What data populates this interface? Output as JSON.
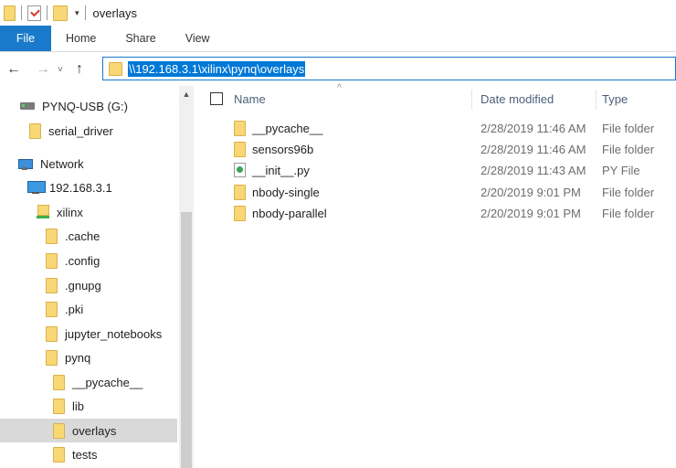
{
  "window": {
    "title": "overlays"
  },
  "ribbon": {
    "tabs": [
      {
        "label": "File"
      },
      {
        "label": "Home"
      },
      {
        "label": "Share"
      },
      {
        "label": "View"
      }
    ]
  },
  "address": {
    "path": "\\\\192.168.3.1\\xilinx\\pynq\\overlays",
    "back_icon": "←",
    "forward_icon": "→",
    "recent_icon": "˅",
    "up_icon": "↑"
  },
  "navigation": {
    "items": [
      {
        "label": "PYNQ-USB (G:)",
        "icon": "usb-drive-icon"
      },
      {
        "label": "serial_driver",
        "icon": "folder-icon"
      },
      {
        "label": "Network",
        "icon": "network-icon"
      },
      {
        "label": "192.168.3.1",
        "icon": "computer-icon"
      },
      {
        "label": "xilinx",
        "icon": "network-share-icon"
      },
      {
        "label": ".cache",
        "icon": "folder-icon"
      },
      {
        "label": ".config",
        "icon": "folder-icon"
      },
      {
        "label": ".gnupg",
        "icon": "folder-icon"
      },
      {
        "label": ".pki",
        "icon": "folder-icon"
      },
      {
        "label": "jupyter_notebooks",
        "icon": "folder-icon"
      },
      {
        "label": "pynq",
        "icon": "folder-icon"
      },
      {
        "label": "__pycache__",
        "icon": "folder-icon"
      },
      {
        "label": "lib",
        "icon": "folder-icon"
      },
      {
        "label": "overlays",
        "icon": "folder-icon",
        "selected": true
      },
      {
        "label": "tests",
        "icon": "folder-icon"
      }
    ]
  },
  "columns": {
    "name": "Name",
    "date": "Date modified",
    "type": "Type",
    "sort_indicator": "^"
  },
  "files": [
    {
      "name": "__pycache__",
      "date": "2/28/2019 11:46 AM",
      "type": "File folder",
      "icon": "folder-icon"
    },
    {
      "name": "sensors96b",
      "date": "2/28/2019 11:46 AM",
      "type": "File folder",
      "icon": "folder-icon"
    },
    {
      "name": "__init__.py",
      "date": "2/28/2019 11:43 AM",
      "type": "PY File",
      "icon": "python-file-icon"
    },
    {
      "name": "nbody-single",
      "date": "2/20/2019 9:01 PM",
      "type": "File folder",
      "icon": "folder-icon"
    },
    {
      "name": "nbody-parallel",
      "date": "2/20/2019 9:01 PM",
      "type": "File folder",
      "icon": "folder-icon"
    }
  ],
  "colors": {
    "accent": "#1979ca",
    "selection": "#0078d7",
    "folder": "#f8d775",
    "nav_selected": "#d9d9d9"
  }
}
